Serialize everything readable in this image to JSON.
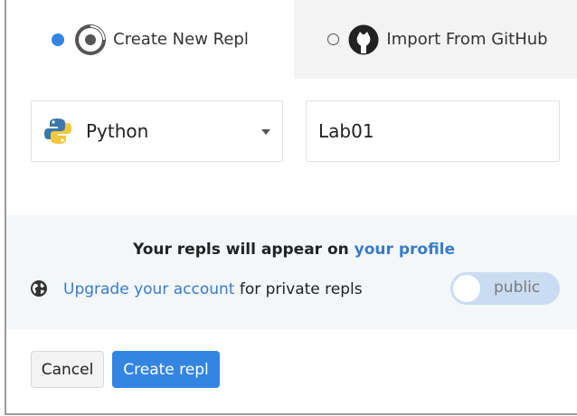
{
  "tabs": {
    "create": {
      "label": "Create New Repl",
      "selected": true
    },
    "import": {
      "label": "Import From GitHub",
      "selected": false
    }
  },
  "language": {
    "selected": "Python"
  },
  "repl_name": {
    "value": "Lab01"
  },
  "info": {
    "profile_prefix": "Your repls will appear on ",
    "profile_link": "your profile",
    "upgrade_link": "Upgrade your account",
    "upgrade_suffix": " for private repls",
    "visibility_toggle": "public"
  },
  "buttons": {
    "cancel": "Cancel",
    "create": "Create repl"
  },
  "colors": {
    "accent": "#3485e2",
    "link": "#3a7bc8",
    "info_bg": "#f3f7fa"
  },
  "icons": [
    "replit-logo-icon",
    "github-icon",
    "python-icon",
    "globe-icon",
    "chevron-down-icon"
  ]
}
